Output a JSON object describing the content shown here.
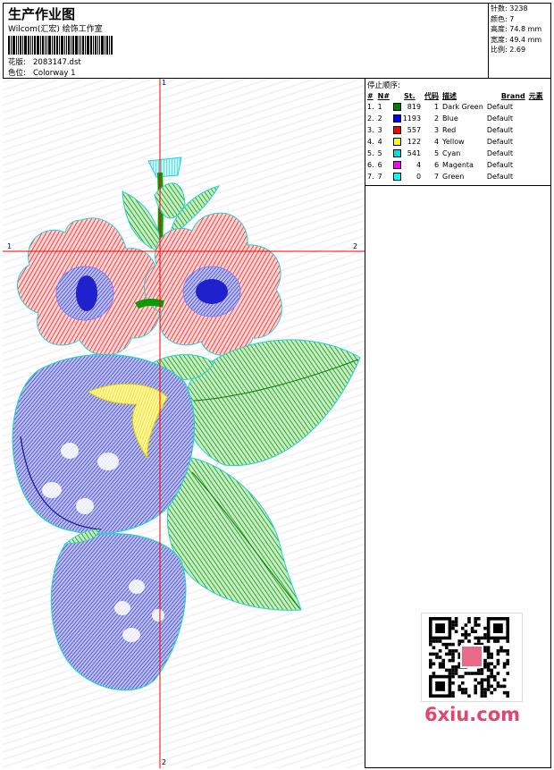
{
  "header": {
    "title": "生产作业图",
    "subtitle": "Wilcom(汇宏) 绘饰工作室",
    "design_label": "花版:",
    "design_value": "2083147.dst",
    "colorway_label": "色位:",
    "colorway_value": "Colorway 1"
  },
  "stats": [
    {
      "label": "针数:",
      "value": "3238"
    },
    {
      "label": "颜色:",
      "value": "7"
    },
    {
      "label": "高度:",
      "value": "74.8 mm"
    },
    {
      "label": "宽度:",
      "value": "49.4 mm"
    },
    {
      "label": "比例:",
      "value": "2.69"
    }
  ],
  "stop_sequence": {
    "title": "停止顺序:",
    "columns": [
      "#",
      "N#",
      "St.",
      "代码",
      "描述",
      "Brand",
      "元素"
    ],
    "rows": [
      {
        "idx": "1.",
        "num": "1",
        "color": "#008000",
        "st": "819",
        "code": "1",
        "desc": "Dark Green",
        "brand": "Default"
      },
      {
        "idx": "2.",
        "num": "2",
        "color": "#0000ff",
        "st": "1193",
        "code": "2",
        "desc": "Blue",
        "brand": "Default"
      },
      {
        "idx": "3.",
        "num": "3",
        "color": "#ff0000",
        "st": "557",
        "code": "3",
        "desc": "Red",
        "brand": "Default"
      },
      {
        "idx": "4.",
        "num": "4",
        "color": "#ffff00",
        "st": "122",
        "code": "4",
        "desc": "Yellow",
        "brand": "Default"
      },
      {
        "idx": "5.",
        "num": "5",
        "color": "#00e0e0",
        "st": "541",
        "code": "5",
        "desc": "Cyan",
        "brand": "Default"
      },
      {
        "idx": "6.",
        "num": "6",
        "color": "#ff00ff",
        "st": "4",
        "code": "6",
        "desc": "Magenta",
        "brand": "Default"
      },
      {
        "idx": "7.",
        "num": "7",
        "color": "#00ffff",
        "st": "0",
        "code": "7",
        "desc": "Green",
        "brand": "Default"
      }
    ]
  },
  "axes": {
    "top": "1",
    "bottom": "2",
    "left": "1",
    "right": "2"
  },
  "watermark": "6xiu.com",
  "colors": {
    "axis": "#ff0000",
    "leaf": "#0a9a0a",
    "flower": "#ff1a1a",
    "berry": "#1a1acc",
    "accent": "#f2e000",
    "outline": "#22d4d4"
  }
}
